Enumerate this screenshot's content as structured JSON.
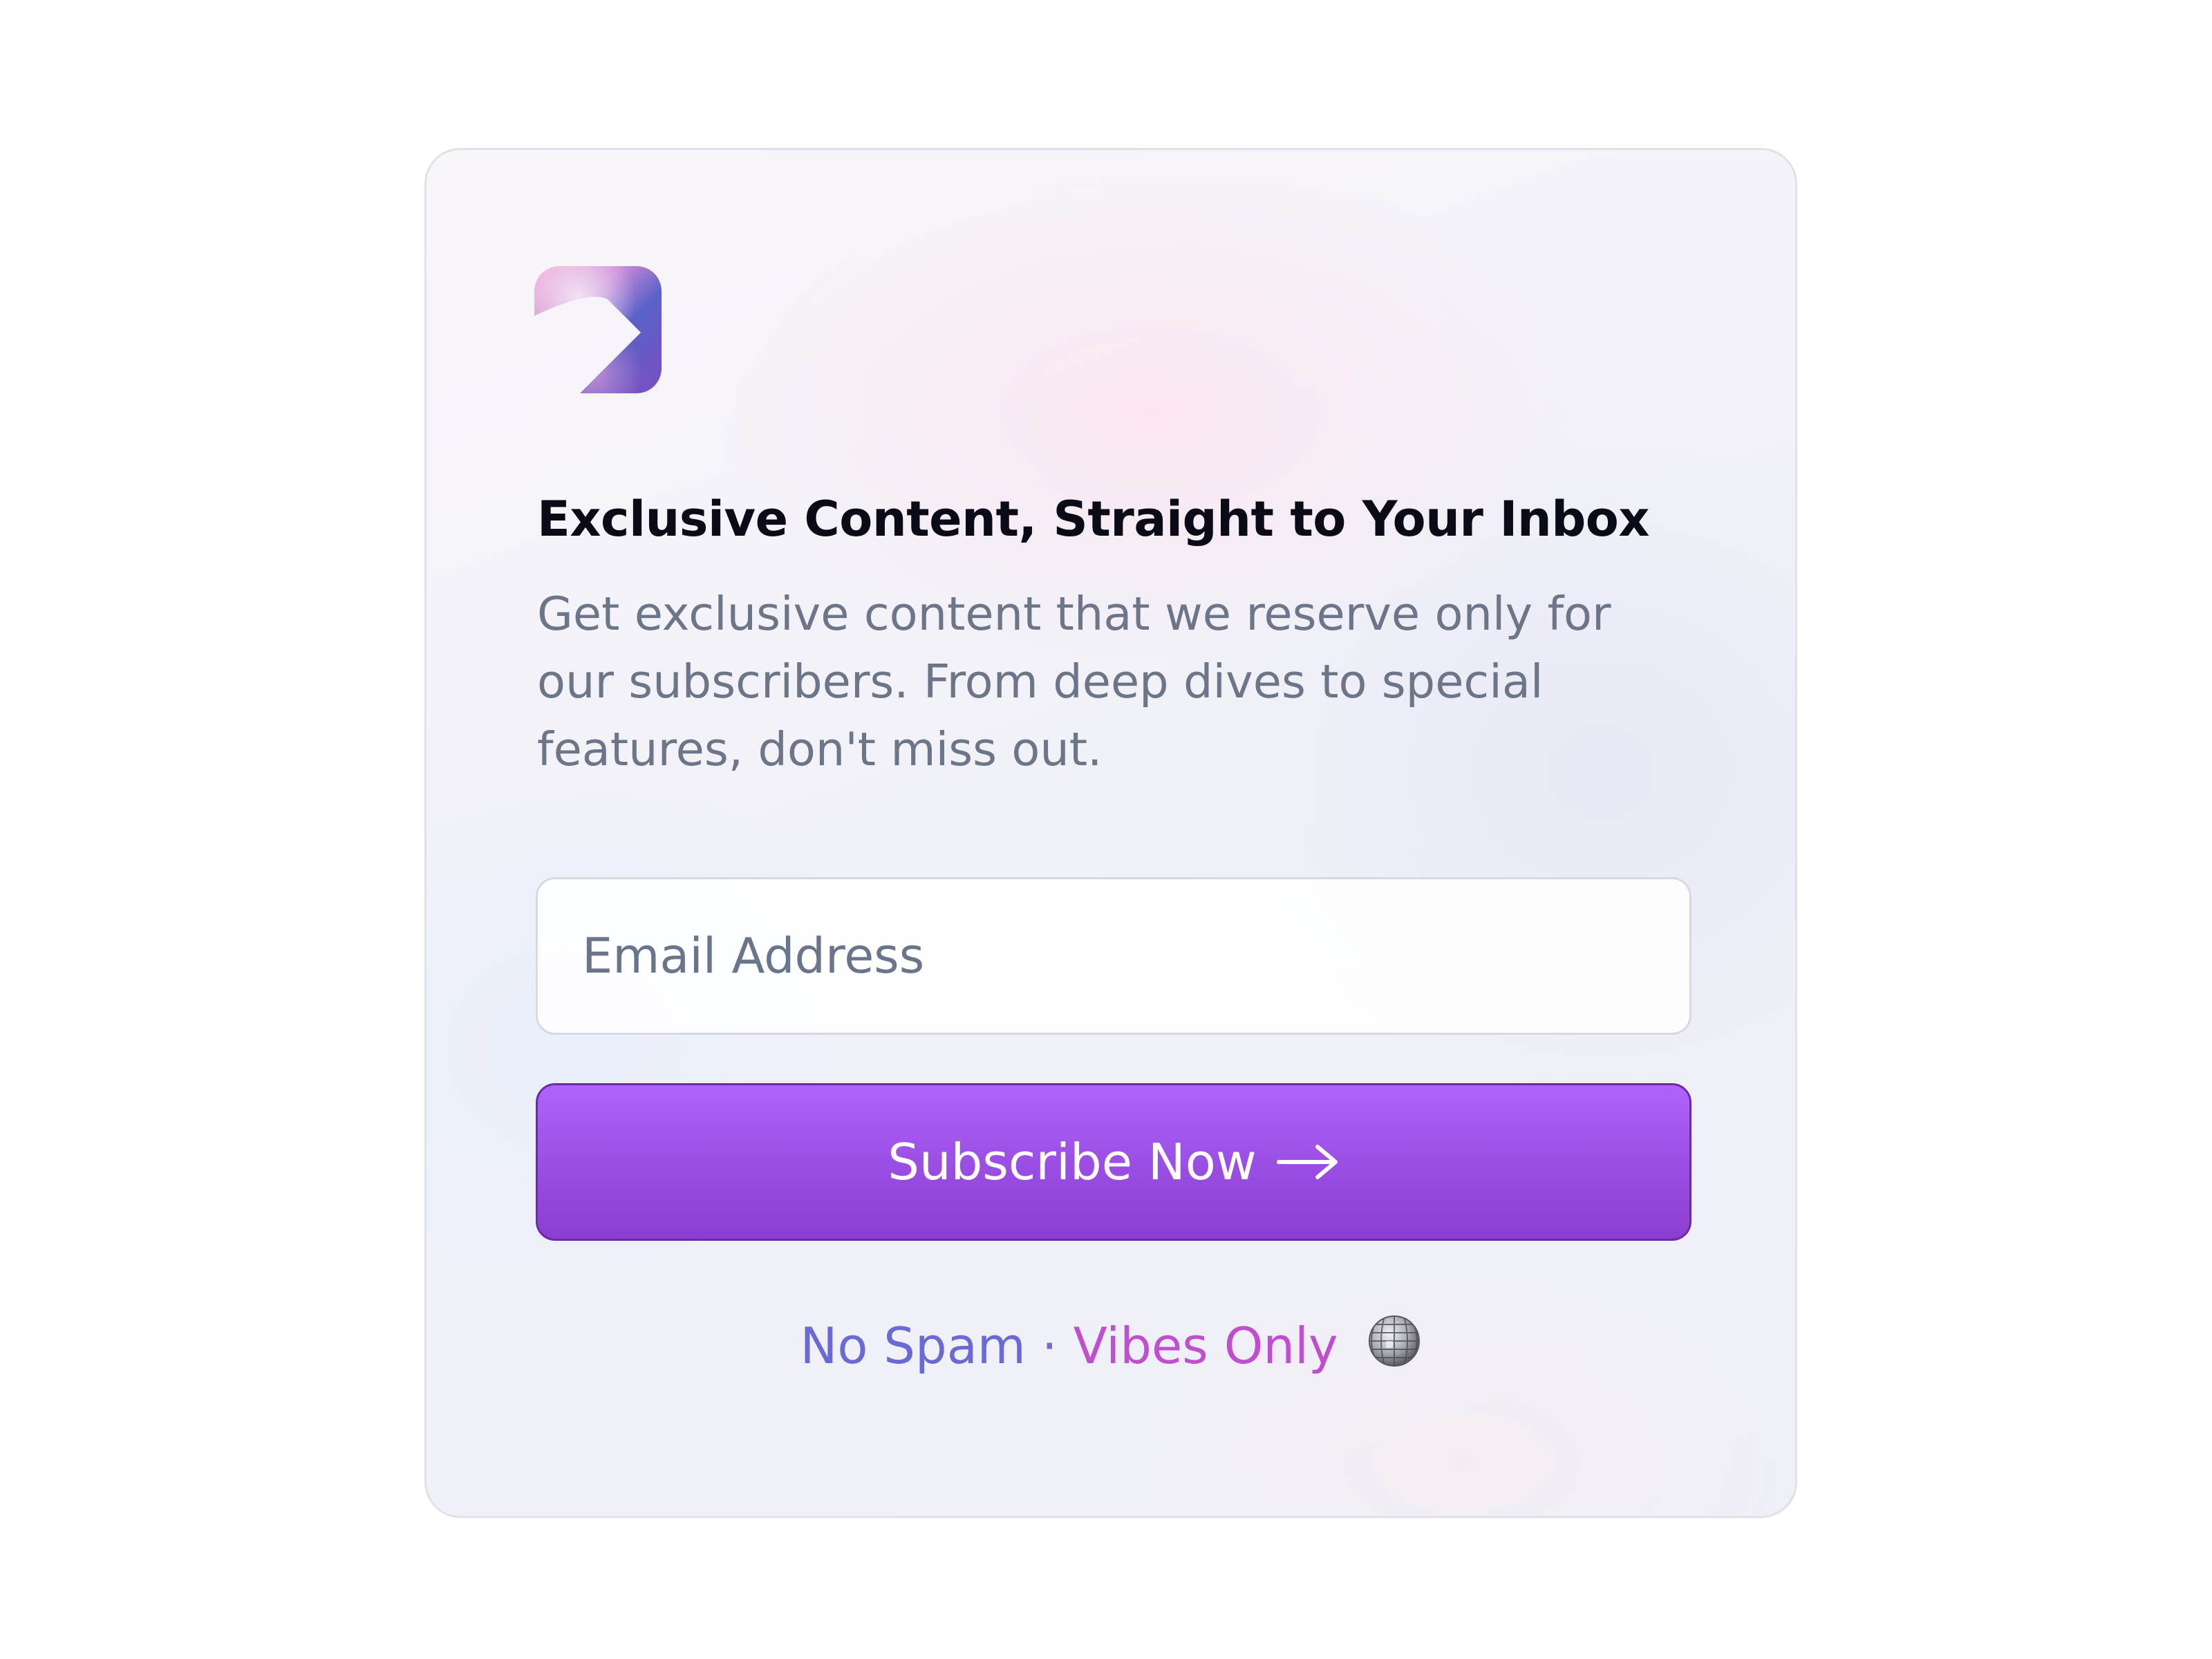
{
  "logo": {
    "icon": "brand-logo-icon"
  },
  "card": {
    "title": "Exclusive Content, Straight to Your Inbox",
    "description": "Get exclusive content that we reserve only for our subscribers. From deep dives to special features, don't miss out."
  },
  "form": {
    "email_placeholder": "Email Address",
    "email_value": "",
    "subscribe_label": "Subscribe Now",
    "subscribe_icon": "arrow-right-icon"
  },
  "footer": {
    "no_spam": "No Spam",
    "separator": "·",
    "vibes_only": "Vibes Only",
    "emoji_icon": "disco-ball-icon"
  },
  "colors": {
    "accent": "#a05af0",
    "accent_dark": "#8b3fd0",
    "title": "#0b0b17",
    "body_text": "#6c7688"
  }
}
